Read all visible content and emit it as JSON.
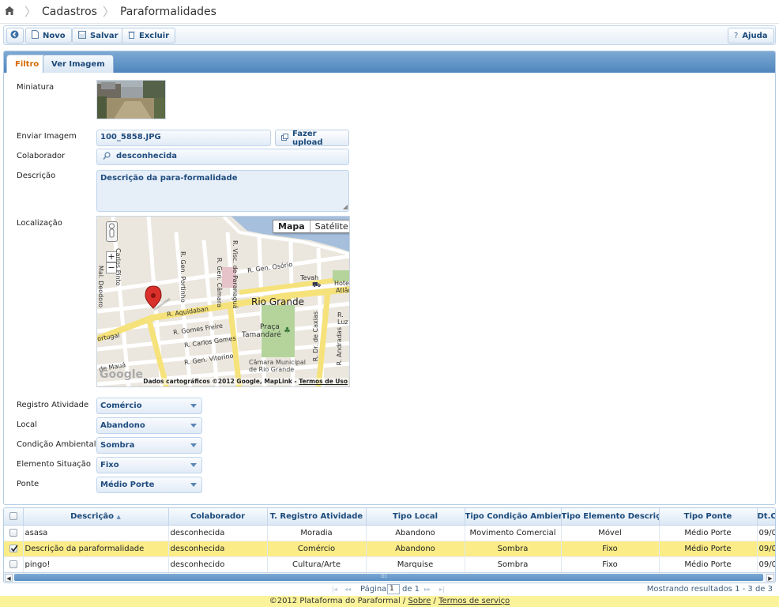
{
  "breadcrumb": {
    "items": [
      "Cadastros",
      "Paraformalidades"
    ]
  },
  "toolbar": {
    "novo": "Novo",
    "salvar": "Salvar",
    "excluir": "Excluir",
    "ajuda": "Ajuda"
  },
  "tabs": [
    "Filtro",
    "Ver Imagem"
  ],
  "form": {
    "miniatura_label": "Miniatura",
    "enviar_label": "Enviar Imagem",
    "enviar_value": "100_5858.JPG",
    "upload_label": "Fazer upload",
    "colaborador_label": "Colaborador",
    "colaborador_value": "desconhecida",
    "descricao_label": "Descrição",
    "descricao_value": "Descrição da para-formalidade",
    "localizacao_label": "Localização",
    "registro_label": "Registro Atividade",
    "registro_value": "Comércio",
    "local_label": "Local",
    "local_value": "Abandono",
    "condicao_label": "Condição Ambiental",
    "condicao_value": "Sombra",
    "elemento_label": "Elemento Situação",
    "elemento_value": "Fixo",
    "ponte_label": "Ponte",
    "ponte_value": "Médio Porte"
  },
  "map": {
    "mapa_btn": "Mapa",
    "satelite_btn": "Satélite",
    "zoom_in": "+",
    "zoom_out": "−",
    "city": "Rio Grande",
    "streets": {
      "aquidaban": "R. Aquidaban",
      "gomes_freire": "R. Gomes Freire",
      "carlos_gomes": "R. Carlos Gomes",
      "vitorino": "R. Gen. Vitorino",
      "portinho": "R. Gen. Portinho",
      "camara": "R. Gen. Câmara",
      "osorio": "R. Gen. Osório",
      "paranagua": "R. Visc. de Paranaguá",
      "caxias": "R. Dr. de Caxias",
      "andradas": "R. Andradas",
      "luz": "R. Luz",
      "portugal": "ortugal",
      "maua": "de Mauá",
      "deodoro": "Mal. Deodoro",
      "pinto": "Carlos Pinto"
    },
    "places": {
      "tevah": "Tevah",
      "hotel": "Hotel",
      "atlan": "Atlân",
      "praca": "Praça",
      "tamandare": "Tamandaré",
      "camara1": "Câmara Municipal",
      "camara2": "de Rio Grande"
    },
    "google": "Google",
    "attribution": "Dados cartográficos ©2012 Google, MapLink - ",
    "terms": "Termos de Uso"
  },
  "grid": {
    "headers": [
      "Descrição",
      "Colaborador",
      "T. Registro Atividade",
      "Tipo Local",
      "Tipo Condição Ambiental",
      "Tipo Elemento Descrição",
      "Tipo Ponte",
      "Dt.C"
    ],
    "sort_arrow": "▲",
    "rows": [
      {
        "checked": false,
        "cells": [
          "asasa",
          "desconhecida",
          "Moradia",
          "Abandono",
          "Movimento Comercial",
          "Móvel",
          "Médio Porte",
          "09/08"
        ]
      },
      {
        "checked": true,
        "cells": [
          "Descrição da paraformalidade",
          "desconhecida",
          "Comércio",
          "Abandono",
          "Sombra",
          "Fixo",
          "Médio Porte",
          "09/08"
        ]
      },
      {
        "checked": false,
        "cells": [
          "pingo!",
          "desconhecido",
          "Cultura/Arte",
          "Marquise",
          "Sombra",
          "Fixo",
          "Médio Porte",
          "09/08"
        ]
      }
    ]
  },
  "pager": {
    "pagina": "Página",
    "page": "1",
    "de": "de 1",
    "first": "|◂",
    "prev": "◂◂",
    "next": "▸▸",
    "last": "▸|",
    "results": "Mostrando resultados 1 - 3 de 3"
  },
  "footer": {
    "copy": "©2012 Plataforma do Paraformal / ",
    "sobre": "Sobre",
    "slash": " / ",
    "termos": "Termos de serviço"
  },
  "colors": {
    "accent": "#4f86bd",
    "active_tab_text": "#d56a00",
    "selected_row": "#fbec88",
    "footer_bg": "#faf39a"
  }
}
